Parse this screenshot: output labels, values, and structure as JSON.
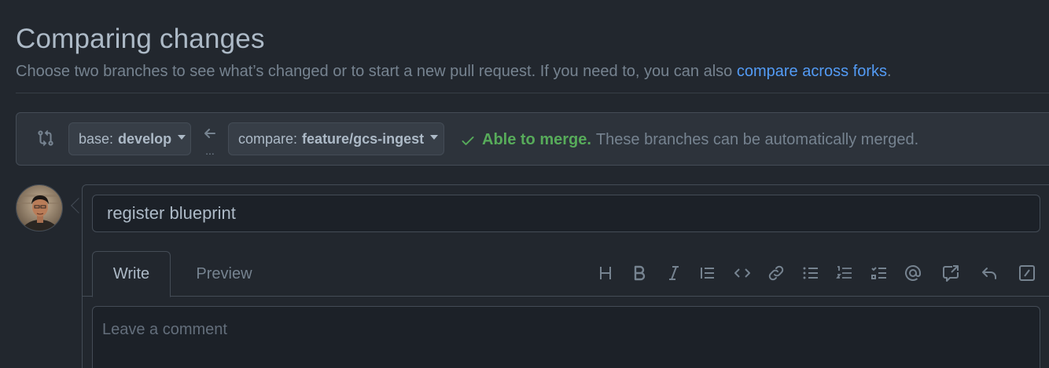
{
  "header": {
    "title": "Comparing changes",
    "subtitle_text": "Choose two branches to see what’s changed or to start a new pull request. If you need to, you can also ",
    "subtitle_link": "compare across forks",
    "subtitle_end": "."
  },
  "range": {
    "base_prefix": "base:",
    "base_branch": "develop",
    "compare_prefix": "compare:",
    "compare_branch": "feature/gcs-ingest",
    "merge_status": "Able to merge.",
    "merge_message": "These branches can be automatically merged.",
    "arrow_dots": "..."
  },
  "composer": {
    "title_value": "register blueprint",
    "tabs": [
      {
        "label": "Write",
        "selected": true
      },
      {
        "label": "Preview",
        "selected": false
      }
    ],
    "toolbar_icons": [
      "heading-icon",
      "bold-icon",
      "italic-icon",
      "quote-icon",
      "code-icon",
      "link-icon",
      "unordered-list-icon",
      "ordered-list-icon",
      "task-list-icon",
      "mention-icon",
      "cross-reference-icon",
      "saved-reply-icon",
      "slash-command-icon"
    ],
    "comment_placeholder": "Leave a comment"
  },
  "colors": {
    "background": "#22272e",
    "link": "#539bf5",
    "success": "#57ab5a",
    "muted": "#768390"
  }
}
